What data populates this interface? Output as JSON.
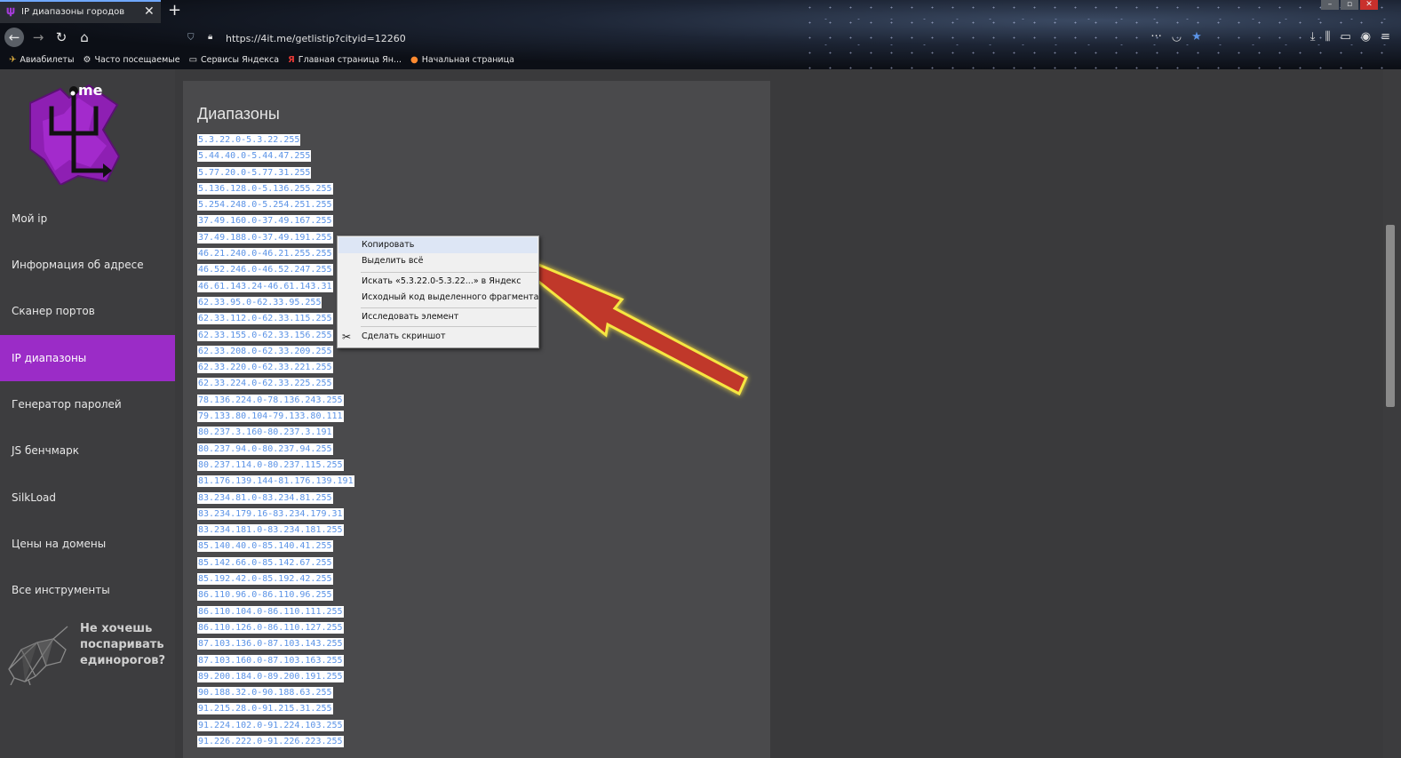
{
  "browser": {
    "tab_title": "IP диапазоны городов",
    "tab_close": "✕",
    "new_tab": "+",
    "url": "https://4it.me/getlistip?cityid=12260",
    "bookmarks": [
      {
        "label": "Авиабилеты",
        "icon": "plane-icon"
      },
      {
        "label": "Часто посещаемые",
        "icon": "gear-icon"
      },
      {
        "label": "Сервисы Яндекса",
        "icon": "folder-icon"
      },
      {
        "label": "Главная страница Ян...",
        "icon": "yandex-icon"
      },
      {
        "label": "Начальная страница",
        "icon": "firefox-icon"
      }
    ]
  },
  "sidebar": {
    "logo_text": "me",
    "items": [
      {
        "label": "Мой ip"
      },
      {
        "label": "Информация об адресе"
      },
      {
        "label": "Сканер портов"
      },
      {
        "label": "IP диапазоны",
        "active": true
      },
      {
        "label": "Генератор паролей"
      },
      {
        "label": "JS бенчмарк"
      },
      {
        "label": "SilkLoad"
      },
      {
        "label": "Цены на домены"
      },
      {
        "label": "Все инструменты"
      }
    ],
    "promo_text": "Не хочешь\nпоспаривать\nединорогов?"
  },
  "main": {
    "heading": "Диапазоны",
    "ranges": [
      "5.3.22.0-5.3.22.255",
      "5.44.40.0-5.44.47.255",
      "5.77.20.0-5.77.31.255",
      "5.136.128.0-5.136.255.255",
      "5.254.248.0-5.254.251.255",
      "37.49.160.0-37.49.167.255",
      "37.49.188.0-37.49.191.255",
      "46.21.240.0-46.21.255.255",
      "46.52.246.0-46.52.247.255",
      "46.61.143.24-46.61.143.31",
      "62.33.95.0-62.33.95.255",
      "62.33.112.0-62.33.115.255",
      "62.33.155.0-62.33.156.255",
      "62.33.208.0-62.33.209.255",
      "62.33.220.0-62.33.221.255",
      "62.33.224.0-62.33.225.255",
      "78.136.224.0-78.136.243.255",
      "79.133.80.104-79.133.80.111",
      "80.237.3.160-80.237.3.191",
      "80.237.94.0-80.237.94.255",
      "80.237.114.0-80.237.115.255",
      "81.176.139.144-81.176.139.191",
      "83.234.81.0-83.234.81.255",
      "83.234.179.16-83.234.179.31",
      "83.234.181.0-83.234.181.255",
      "85.140.40.0-85.140.41.255",
      "85.142.66.0-85.142.67.255",
      "85.192.42.0-85.192.42.255",
      "86.110.96.0-86.110.96.255",
      "86.110.104.0-86.110.111.255",
      "86.110.126.0-86.110.127.255",
      "87.103.136.0-87.103.143.255",
      "87.103.160.0-87.103.163.255",
      "89.200.184.0-89.200.191.255",
      "90.188.32.0-90.188.63.255",
      "91.215.28.0-91.215.31.255",
      "91.224.102.0-91.224.103.255",
      "91.226.222.0-91.226.223.255"
    ]
  },
  "context_menu": {
    "items": [
      "Копировать",
      "Выделить всё",
      "Искать «5.3.22.0-5.3.22...» в Яндекс",
      "Исходный код выделенного фрагмента",
      "Исследовать элемент",
      "Сделать скриншот"
    ]
  },
  "colors": {
    "accent": "#9b2cc7",
    "link_blue": "#5b93e6",
    "annotation_arrow": "#c0392b"
  }
}
